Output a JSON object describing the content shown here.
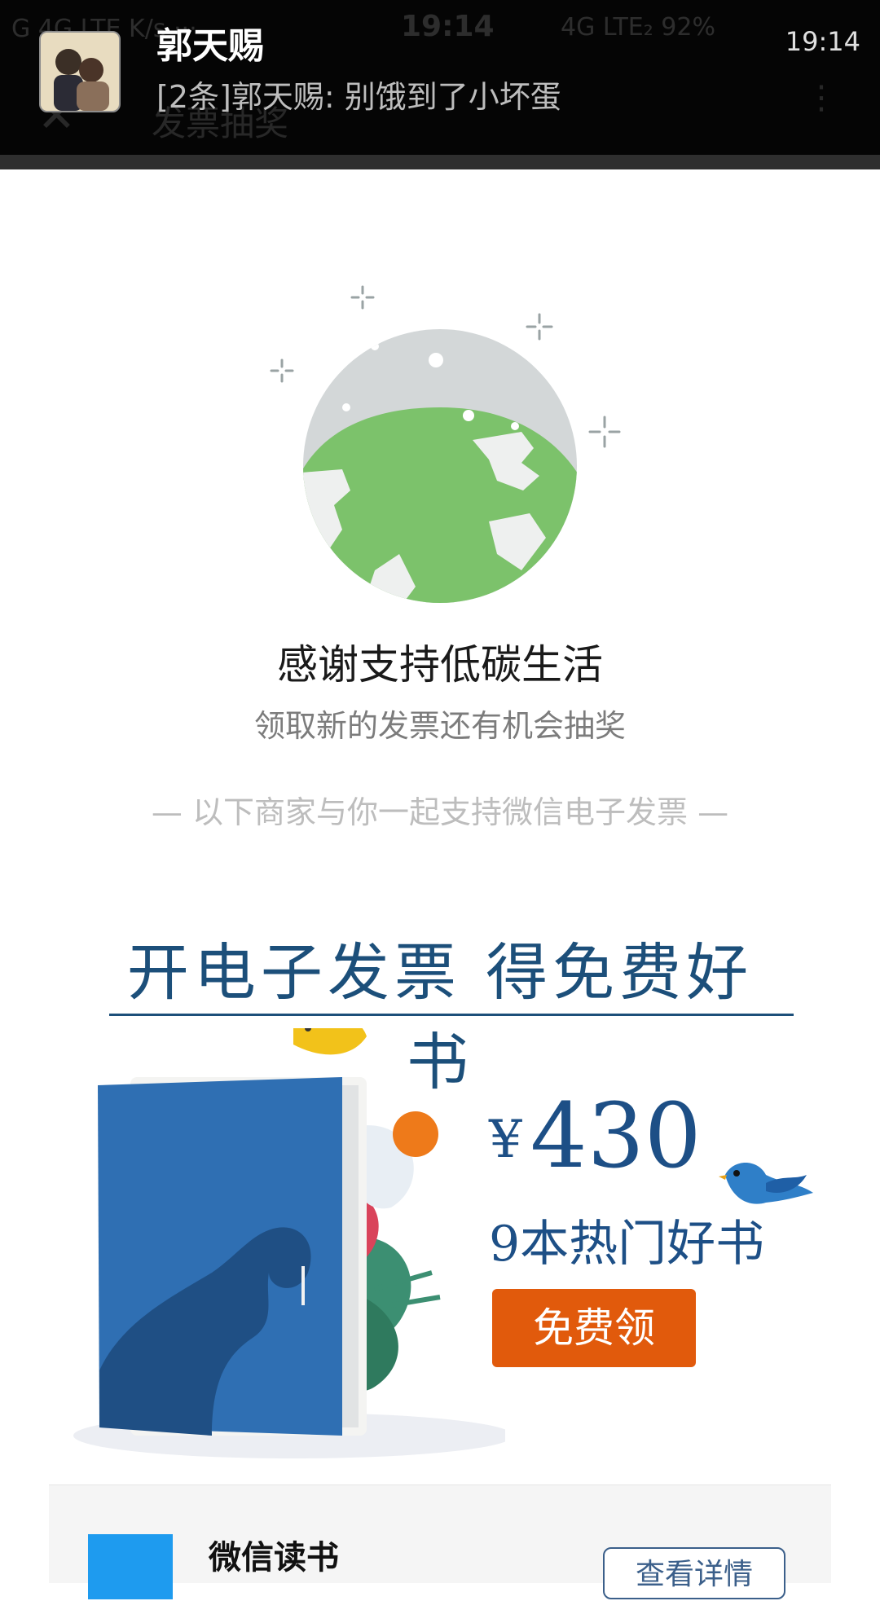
{
  "status_bar_ghost": {
    "left": "G  4G LTE  K/s ···",
    "time": "19:14",
    "right": "4G LTE₂ 92%"
  },
  "app_bar_ghost": {
    "back_glyph": "✕",
    "title": "发票抽奖",
    "menu_glyph": "⋮"
  },
  "notification": {
    "title": "郭天赐",
    "message": "[2条]郭天赐: 别饿到了小坏蛋",
    "time": "19:14"
  },
  "thanks": {
    "headline": "感谢支持低碳生活",
    "subline": "领取新的发票还有机会抽奖"
  },
  "divider_text": "— 以下商家与你一起支持微信电子发票 —",
  "promo": {
    "title": "开电子发票  得免费好书",
    "currency": "¥",
    "amount": "430",
    "books_text": "9本热门好书",
    "button_label": "免费领"
  },
  "merchant": {
    "name": "微信读书",
    "detail_button": "查看详情"
  },
  "colors": {
    "globe_green": "#7cc26b",
    "globe_sky": "#d3d7d8",
    "promo_blue": "#1c4f7a",
    "button_orange": "#e15a0c"
  }
}
